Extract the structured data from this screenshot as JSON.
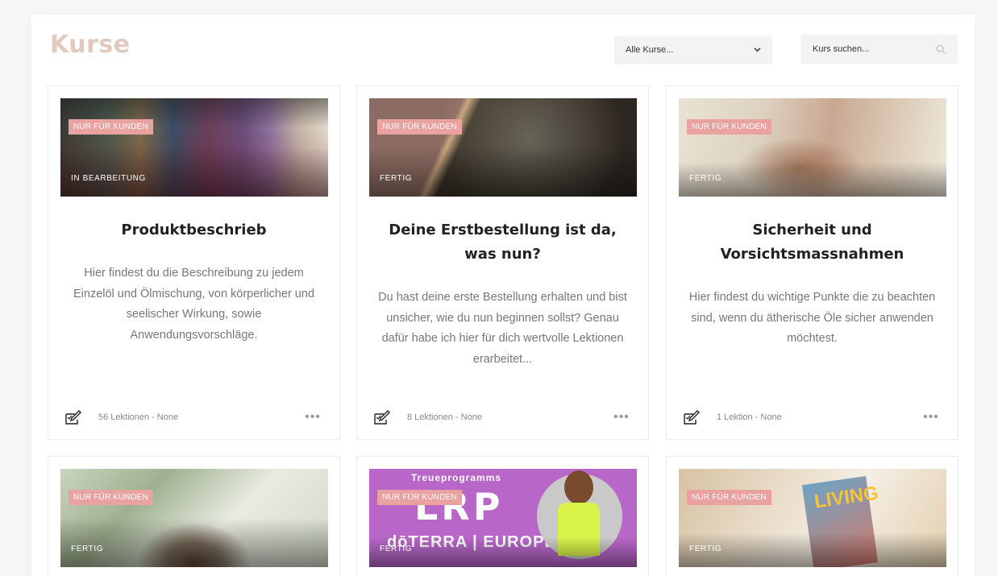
{
  "header": {
    "title": "Kurse",
    "filter_label": "Alle Kurse...",
    "search_placeholder": "Kurs suchen..."
  },
  "badge_text": "NUR FÜR KUNDEN",
  "cards": [
    {
      "status": "IN BEARBEITUNG",
      "title": "Produktbeschrieb",
      "description": "Hier findest du die Beschreibung zu jedem Einzelöl und Ölmischung, von körperlicher und seelischer Wirkung, sowie Anwendungsvorschläge.",
      "meta": "56 Lektionen - None"
    },
    {
      "status": "FERTIG",
      "title": "Deine Erstbestellung ist da, was nun?",
      "description": "Du hast deine erste Bestellung erhalten und bist unsicher, wie du nun beginnen sollst? Genau dafür habe ich hier für dich wertvolle Lektionen erarbeitet...",
      "meta": "8 Lektionen - None"
    },
    {
      "status": "FERTIG",
      "title": "Sicherheit und Vorsichtsmassnahmen",
      "description": "Hier findest du wichtige Punkte die zu beachten sind, wenn du ätherische Öle sicher anwenden möchtest.",
      "meta": "1 Lektion - None"
    },
    {
      "status": "FERTIG"
    },
    {
      "status": "FERTIG",
      "image_text": {
        "line1": "Treueprogramms",
        "line2": "LRP",
        "line3": "dōTERRA | EUROPE"
      }
    },
    {
      "status": "FERTIG",
      "image_text": {
        "magazine": "LIVING"
      }
    }
  ],
  "colors": {
    "accent": "#e2c9bd",
    "badge": "#e9a2a0"
  }
}
